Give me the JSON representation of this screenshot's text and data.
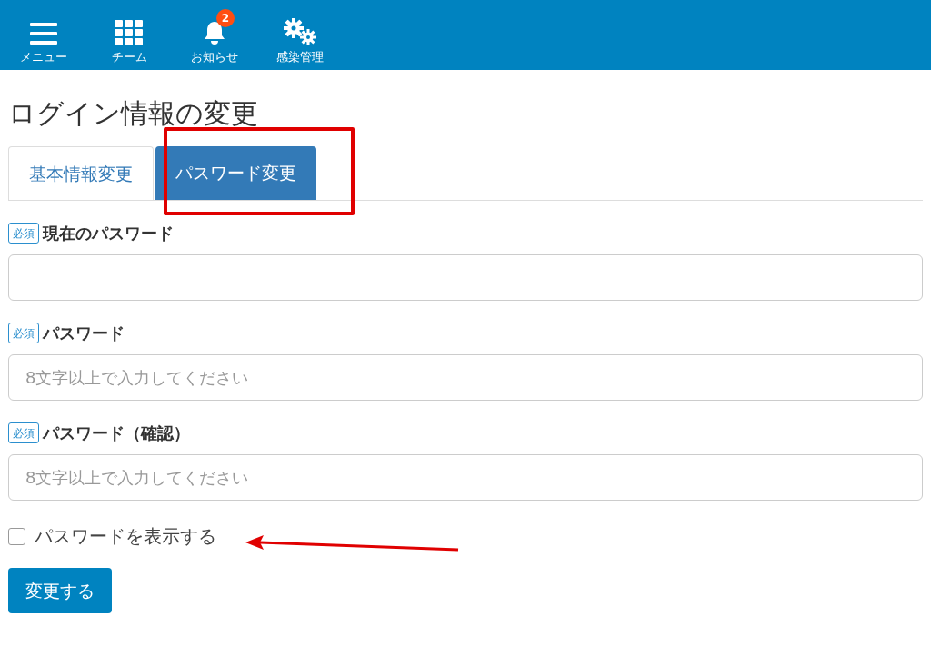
{
  "nav": [
    {
      "kind": "menu",
      "label": "メニュー"
    },
    {
      "kind": "grid",
      "label": "チーム"
    },
    {
      "kind": "bell",
      "label": "お知らせ",
      "badge": "2"
    },
    {
      "kind": "gears",
      "label": "感染管理"
    }
  ],
  "title": "ログイン情報の変更",
  "tabs": [
    {
      "label": "基本情報変更",
      "selected": false
    },
    {
      "label": "パスワード変更",
      "selected": true
    }
  ],
  "fields": [
    {
      "required": "必須",
      "label": "現在のパスワード"
    },
    {
      "required": "必須",
      "label": "パスワード",
      "placeholder": "8文字以上で入力してください"
    },
    {
      "required": "必須",
      "label": "パスワード（確認）",
      "placeholder": "8文字以上で入力してください"
    }
  ],
  "show_password": {
    "label": "パスワードを表示する",
    "checked": false
  },
  "submit": "変更する"
}
